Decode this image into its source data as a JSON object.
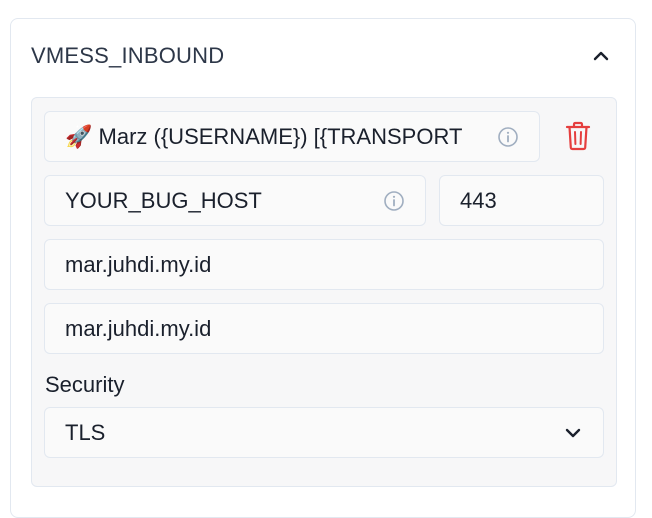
{
  "header": {
    "title": "VMESS_INBOUND"
  },
  "host_row": {
    "remark_value": "🚀 Marz ({USERNAME}) [{TRANSPORT",
    "address_value": "YOUR_BUG_HOST",
    "port_value": "443",
    "sni_value": "mar.juhdi.my.id",
    "host_value": "mar.juhdi.my.id"
  },
  "security": {
    "label": "Security",
    "selected": "TLS"
  },
  "colors": {
    "delete": "#e53e3e",
    "icon_gray": "#a0aec0"
  },
  "icons": {
    "collapse": "chevron-up-icon",
    "info": "info-icon",
    "delete": "trash-icon",
    "dropdown": "chevron-down-icon"
  }
}
